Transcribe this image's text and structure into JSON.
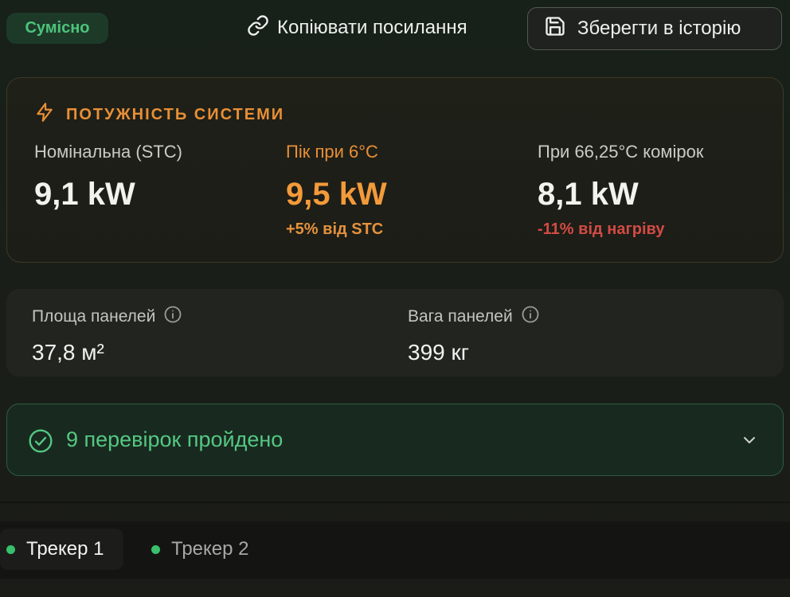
{
  "header": {
    "mode_badge": "Сумісно",
    "copy_link_label": "Копіювати посилання",
    "save_label": "Зберегти в історію"
  },
  "power": {
    "title": "ПОТУЖНІСТЬ СИСТЕМИ",
    "nominal": {
      "label": "Номінальна (STC)",
      "value": "9,1 kW"
    },
    "peak": {
      "label": "Пік при 6°C",
      "value": "9,5 kW",
      "delta": "+5% від STC"
    },
    "hot": {
      "label": "При 66,25°C комірок",
      "value": "8,1 kW",
      "delta": "-11% від нагріву"
    }
  },
  "stats": {
    "area": {
      "label": "Площа панелей",
      "value": "37,8 м²"
    },
    "weight": {
      "label": "Вага панелей",
      "value": "399 кг"
    }
  },
  "checks": {
    "label": "9 перевірок пройдено"
  },
  "tabs": [
    {
      "label": "Трекер 1",
      "active": true
    },
    {
      "label": "Трекер 2",
      "active": false
    }
  ],
  "colors": {
    "accent_orange": "#f39a3a",
    "success_green": "#55c783",
    "danger_red": "#d24b44"
  },
  "icons": [
    "link-icon",
    "save-icon",
    "bolt-icon",
    "info-icon",
    "check-circle-icon",
    "chevron-down-icon"
  ]
}
